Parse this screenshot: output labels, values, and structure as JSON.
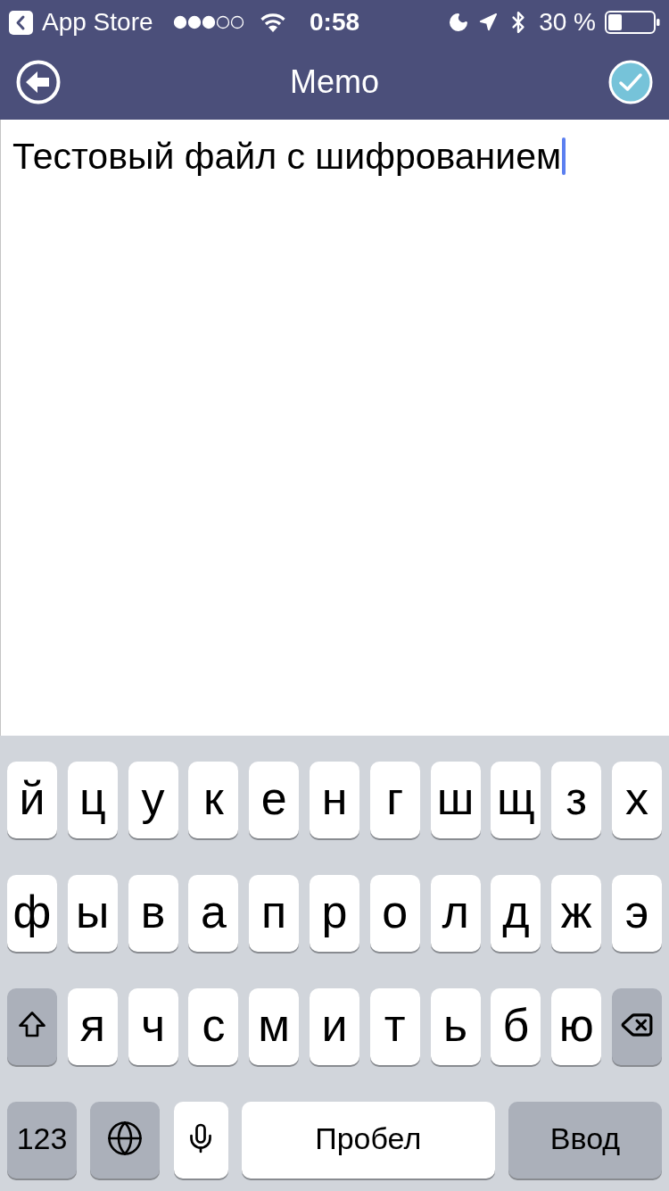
{
  "status_bar": {
    "back_label": "App Store",
    "time": "0:58",
    "battery_text": "30 %"
  },
  "nav_bar": {
    "title": "Memo"
  },
  "editor": {
    "value": "Тестовый файл с шифрованием",
    "focused": true
  },
  "keyboard": {
    "rows": [
      {
        "keys": [
          {
            "kind": "letter",
            "label": "й"
          },
          {
            "kind": "letter",
            "label": "ц"
          },
          {
            "kind": "letter",
            "label": "у"
          },
          {
            "kind": "letter",
            "label": "к"
          },
          {
            "kind": "letter",
            "label": "е"
          },
          {
            "kind": "letter",
            "label": "н"
          },
          {
            "kind": "letter",
            "label": "г"
          },
          {
            "kind": "letter",
            "label": "ш"
          },
          {
            "kind": "letter",
            "label": "щ"
          },
          {
            "kind": "letter",
            "label": "з"
          },
          {
            "kind": "letter",
            "label": "х"
          }
        ]
      },
      {
        "keys": [
          {
            "kind": "letter",
            "label": "ф"
          },
          {
            "kind": "letter",
            "label": "ы"
          },
          {
            "kind": "letter",
            "label": "в"
          },
          {
            "kind": "letter",
            "label": "а"
          },
          {
            "kind": "letter",
            "label": "п"
          },
          {
            "kind": "letter",
            "label": "р"
          },
          {
            "kind": "letter",
            "label": "о"
          },
          {
            "kind": "letter",
            "label": "л"
          },
          {
            "kind": "letter",
            "label": "д"
          },
          {
            "kind": "letter",
            "label": "ж"
          },
          {
            "kind": "letter",
            "label": "э"
          }
        ]
      },
      {
        "keys": [
          {
            "kind": "shift"
          },
          {
            "kind": "letter",
            "label": "я"
          },
          {
            "kind": "letter",
            "label": "ч"
          },
          {
            "kind": "letter",
            "label": "с"
          },
          {
            "kind": "letter",
            "label": "м"
          },
          {
            "kind": "letter",
            "label": "и"
          },
          {
            "kind": "letter",
            "label": "т"
          },
          {
            "kind": "letter",
            "label": "ь"
          },
          {
            "kind": "letter",
            "label": "б"
          },
          {
            "kind": "letter",
            "label": "ю"
          },
          {
            "kind": "backspace"
          }
        ]
      },
      {
        "keys": [
          {
            "kind": "numbers",
            "label": "123"
          },
          {
            "kind": "globe"
          },
          {
            "kind": "mic"
          },
          {
            "kind": "space",
            "label": "Пробел"
          },
          {
            "kind": "return",
            "label": "Ввод"
          }
        ]
      }
    ]
  }
}
